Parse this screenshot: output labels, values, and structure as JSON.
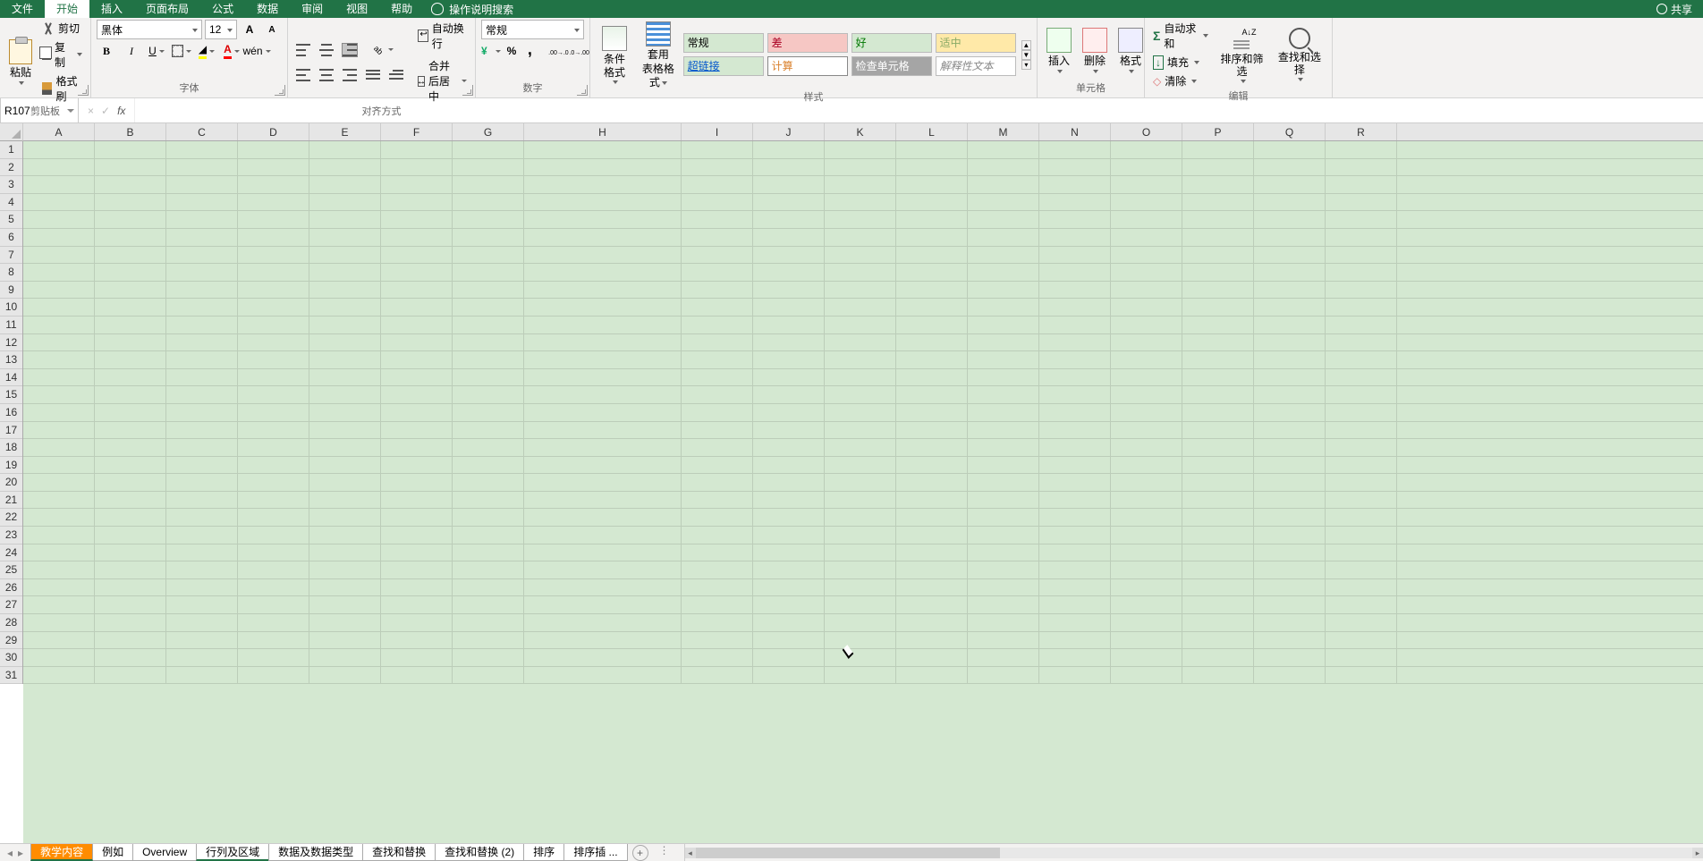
{
  "tabs": {
    "file": "文件",
    "home": "开始",
    "insert": "插入",
    "pagelayout": "页面布局",
    "formulas": "公式",
    "data": "数据",
    "review": "审阅",
    "view": "视图",
    "help": "帮助",
    "tellme": "操作说明搜索"
  },
  "share": "共享",
  "clipboard": {
    "paste": "粘贴",
    "cut": "剪切",
    "copy": "复制",
    "painter": "格式刷",
    "group": "剪贴板"
  },
  "font": {
    "name": "黑体",
    "size": "12",
    "group": "字体",
    "B": "B",
    "I": "I",
    "U": "U",
    "A_label": "A",
    "increase": "A",
    "decrease": "A"
  },
  "align": {
    "group": "对齐方式",
    "wrap": "自动换行",
    "merge": "合并后居中"
  },
  "number": {
    "format": "常规",
    "group": "数字"
  },
  "condfmt": "条件格式",
  "fmttable": {
    "l1": "套用",
    "l2": "表格格式"
  },
  "styles": {
    "group": "样式",
    "normal": "常规",
    "bad": "差",
    "good": "好",
    "neutral": "适中",
    "link": "超链接",
    "calc": "计算",
    "check": "检查单元格",
    "note": "解释性文本"
  },
  "cells": {
    "insert": "插入",
    "delete": "删除",
    "format": "格式",
    "group": "单元格"
  },
  "editing": {
    "sum": "自动求和",
    "fill": "填充",
    "clear": "清除",
    "sortf": "排序和筛选",
    "find": "查找和选择",
    "group": "编辑"
  },
  "namebox": "R107",
  "fx": "fx",
  "cancel": "×",
  "enter": "✓",
  "columns": [
    "A",
    "B",
    "C",
    "D",
    "E",
    "F",
    "G",
    "H",
    "I",
    "J",
    "K",
    "L",
    "M",
    "N",
    "O",
    "P",
    "Q",
    "R"
  ],
  "sheets": [
    "教学内容",
    "例如",
    "Overview",
    "行列及区域",
    "数据及数据类型",
    "查找和替换",
    "查找和替换 (2)",
    "排序",
    "排序插 ..."
  ],
  "add": "+",
  "ellipsis": "..."
}
